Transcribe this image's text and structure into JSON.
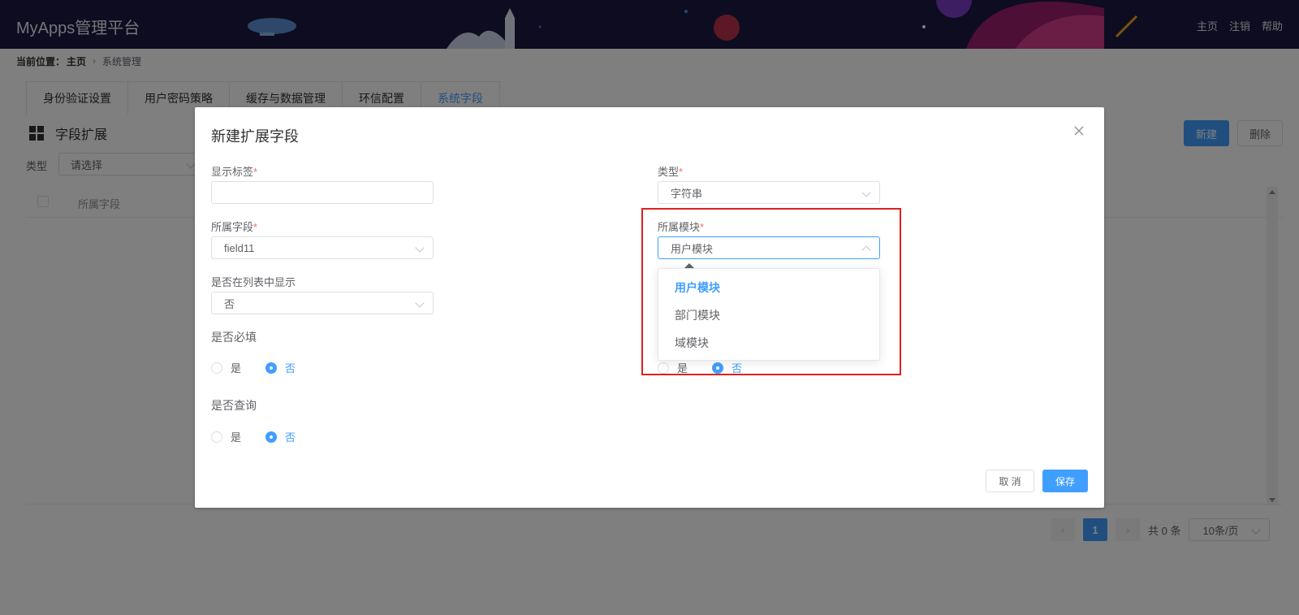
{
  "header": {
    "app_title": "MyApps管理平台",
    "nav": [
      "主页",
      "注销",
      "帮助"
    ],
    "colors": {
      "background": "#1c1940",
      "text": "#e8e8f0"
    }
  },
  "breadcrumb": {
    "label": "当前位置：",
    "home": "主页",
    "current": "系统管理"
  },
  "tabs": [
    "身份验证设置",
    "用户密码策略",
    "缓存与数据管理",
    "环信配置",
    "系统字段"
  ],
  "active_tab": "系统字段",
  "section": {
    "title": "字段扩展",
    "new_button": "新建",
    "delete_button": "删除"
  },
  "filter": {
    "label": "类型",
    "placeholder": "请选择"
  },
  "table": {
    "columns": [
      "所属字段"
    ]
  },
  "pagination": {
    "current_page": "1",
    "total": "共 0 条",
    "page_size": "10条/页",
    "prev": "‹",
    "next": "›"
  },
  "dialog": {
    "title": "新建扩展字段",
    "close_icon": "close-icon",
    "fields": {
      "display_label": {
        "label": "显示标签",
        "required": "*",
        "value": ""
      },
      "type": {
        "label": "类型",
        "required": "*",
        "value": "字符串"
      },
      "field": {
        "label": "所属字段",
        "required": "*",
        "value": "field11"
      },
      "module": {
        "label": "所属模块",
        "required": "*",
        "value": "用户模块"
      },
      "show_in_list": {
        "label": "是否在列表中显示",
        "value": "否"
      },
      "required_field": {
        "label": "是否必填",
        "yes": "是",
        "no": "否",
        "selected": "否"
      },
      "query_field": {
        "label": "是否查询",
        "yes": "是",
        "no": "否",
        "selected": "否"
      },
      "hidden_radio": {
        "yes": "是",
        "no": "否",
        "selected": "否"
      }
    },
    "cancel_button": "取 消",
    "save_button": "保存"
  },
  "module_dropdown": {
    "options": [
      "用户模块",
      "部门模块",
      "域模块"
    ],
    "selected": "用户模块"
  },
  "colors": {
    "primary": "#409eff",
    "required": "#f56c6c",
    "highlight": "#e02020"
  }
}
